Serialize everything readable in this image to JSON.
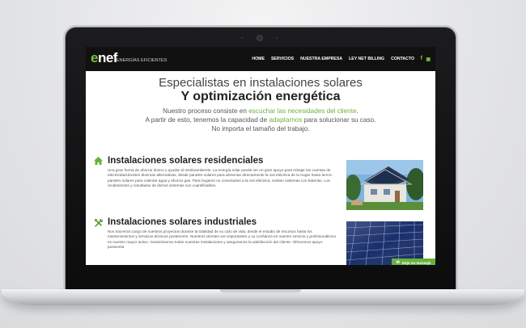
{
  "nav": {
    "logo": "enef",
    "logo_tagline": "ENERGÍAS EFICIENTES",
    "items": [
      {
        "label": "HOME"
      },
      {
        "label": "SERVICIOS"
      },
      {
        "label": "NUESTRA EMPRESA"
      },
      {
        "label": "LEY NET BILLING"
      },
      {
        "label": "CONTACTO"
      }
    ],
    "social": {
      "facebook": "f",
      "instagram": "▣"
    }
  },
  "hero": {
    "title_line1": "Especialistas en instalaciones solares",
    "title_line2": "Y optimización energética",
    "p1_a": "Nuestro proceso consiste en ",
    "p1_hl": "escuchar las necesidades del cliente",
    "p1_b": ".",
    "p2_a": "A partir de esto, tenemos la capacidad de ",
    "p2_hl": "adaptarnos",
    "p2_b": " para solucionar su caso.",
    "p3": "No importa el tamaño del trabajo."
  },
  "sections": [
    {
      "title": "Instalaciones solares residenciales",
      "icon": "house-icon",
      "text": "Una gran forma de ahorrar dinero y ayudar al medioambiente. La energía solar puede ser un gran apoyo para rebajar las cuentas de electricidad.Existen diversas alternativas, desde paneles solares para alimentar directamente la red eléctrica de tu hogar hasta termo-paneles solares para calentar agua y ahorrar gas. Para hogares no conectados a la red eléctrica, existen sistemas con baterías. Los rendimientos y resultados de dichos sistemas son cuantificables."
    },
    {
      "title": "Instalaciones solares industriales",
      "icon": "tools-icon",
      "text": "Nos hacemos cargo de nuestros proyectos durante la totalidad de su ciclo de vida, desde el estudio de recursos hasta los mantenimientos y servicios técnicos posteriores. Nuestros clientes son importantes y su confianza en nuestro servicio y profesionalismo es nuestro mayor activo. Garantizamos todas nuestras instalaciones y aseguramos la satisfacción del cliente. Ofrecemos apoyo postventa"
    }
  ],
  "chat": {
    "label": "Deje un mensaje"
  },
  "colors": {
    "accent": "#6ab23e",
    "nav_bg": "#111111"
  }
}
